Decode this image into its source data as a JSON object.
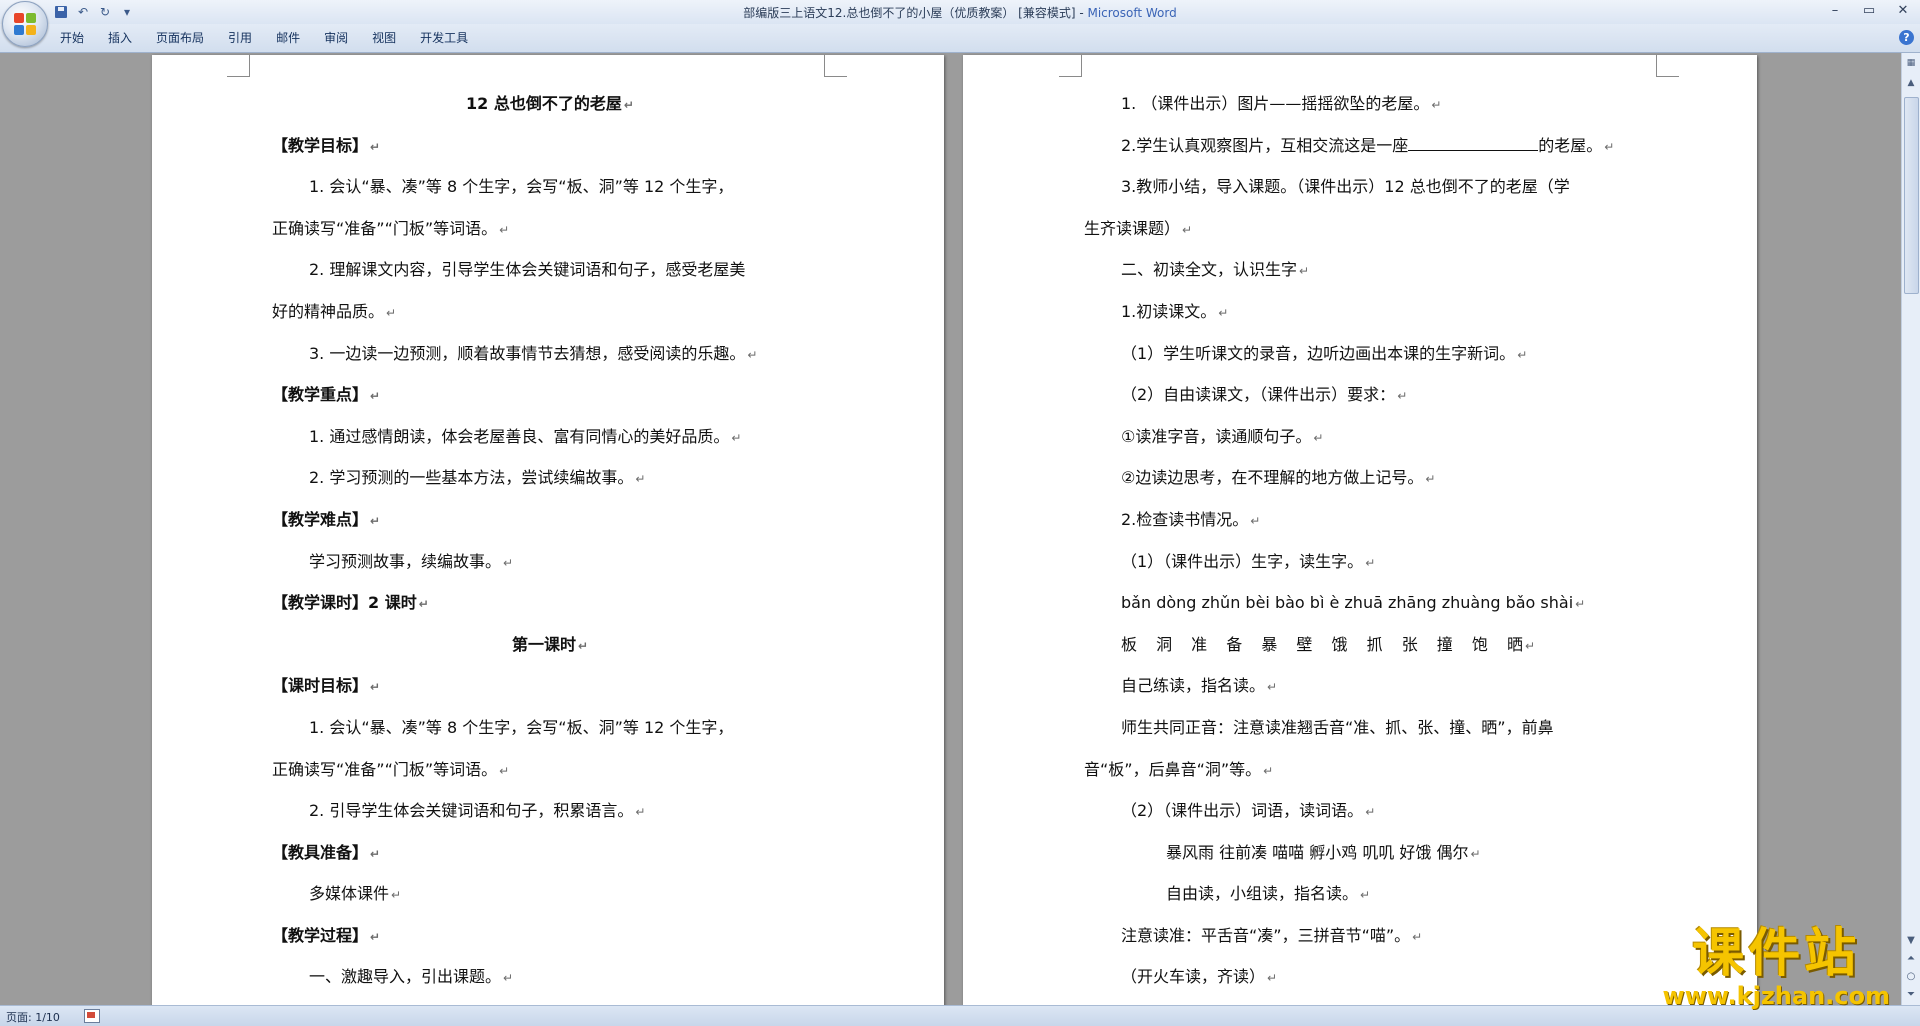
{
  "titlebar": {
    "title": "部编版三上语文12.总也倒不了的小屋（优质教案） [兼容模式] - ",
    "app": "Microsoft Word",
    "minimize": "–",
    "restore": "▭",
    "close": "✕"
  },
  "quick_access": {
    "undo_glyph": "↶",
    "redo_glyph": "↻",
    "customize_glyph": "▾"
  },
  "ribbon_tabs": [
    "开始",
    "插入",
    "页面布局",
    "引用",
    "邮件",
    "审阅",
    "视图",
    "开发工具"
  ],
  "help": "?",
  "paragraph_mark": "↵",
  "left_page": [
    {
      "text": "12 总也倒不了的老屋",
      "style": "center bold"
    },
    {
      "text": "【教学目标】",
      "style": "bold"
    },
    {
      "text": "1. 会认“暴、凑”等 8 个生字，会写“板、洞”等 12 个生字，",
      "style": "indent",
      "nomark": true
    },
    {
      "text": "正确读写“准备”“门板”等词语。",
      "style": ""
    },
    {
      "text": "2. 理解课文内容，引导学生体会关键词语和句子，感受老屋美",
      "style": "indent",
      "nomark": true
    },
    {
      "text": "好的精神品质。",
      "style": ""
    },
    {
      "text": "3. 一边读一边预测，顺着故事情节去猜想，感受阅读的乐趣。",
      "style": "indent"
    },
    {
      "text": "【教学重点】",
      "style": "bold"
    },
    {
      "text": "1. 通过感情朗读，体会老屋善良、富有同情心的美好品质。",
      "style": "indent"
    },
    {
      "text": "2. 学习预测的一些基本方法，尝试续编故事。",
      "style": "indent"
    },
    {
      "text": "【教学难点】",
      "style": "bold"
    },
    {
      "text": "学习预测故事，续编故事。",
      "style": "indent"
    },
    {
      "text": "【教学课时】2 课时",
      "style": "bold"
    },
    {
      "text": "第一课时",
      "style": "center bold"
    },
    {
      "text": "【课时目标】",
      "style": "bold"
    },
    {
      "text": "1. 会认“暴、凑”等 8 个生字，会写“板、洞”等 12 个生字，",
      "style": "indent",
      "nomark": true
    },
    {
      "text": "正确读写“准备”“门板”等词语。",
      "style": ""
    },
    {
      "text": "2. 引导学生体会关键词语和句子，积累语言。",
      "style": "indent"
    },
    {
      "text": "【教具准备】",
      "style": "bold"
    },
    {
      "text": "多媒体课件",
      "style": "indent"
    },
    {
      "text": "【教学过程】",
      "style": "bold"
    },
    {
      "text": "一、激趣导入，引出课题。",
      "style": "indent"
    }
  ],
  "right_page": [
    {
      "text": "1. （课件出示）图片——摇摇欲坠的老屋。",
      "style": "indent"
    },
    {
      "text": "2.学生认真观察图片，互相交流这是一座",
      "tail": "的老屋。",
      "blank": true,
      "style": "indent"
    },
    {
      "text": "3.教师小结，导入课题。（课件出示）12 总也倒不了的老屋（学",
      "style": "indent",
      "nomark": true
    },
    {
      "text": "生齐读课题）",
      "style": ""
    },
    {
      "text": "二、初读全文，认识生字",
      "style": "indent"
    },
    {
      "text": "1.初读课文。",
      "style": "indent"
    },
    {
      "text": "（1）学生听课文的录音，边听边画出本课的生字新词。",
      "style": "indent"
    },
    {
      "text": "（2）自由读课文，（课件出示）要求：",
      "style": "indent"
    },
    {
      "text": "①读准字音，读通顺句子。",
      "style": "indent"
    },
    {
      "text": "②边读边思考，在不理解的地方做上记号。",
      "style": "indent"
    },
    {
      "text": "2.检查读书情况。",
      "style": "indent"
    },
    {
      "text": "（1）（课件出示）生字，读生字。",
      "style": "indent"
    },
    {
      "text": "bǎn dòng zhǔn bèi bào bì è zhuā zhāng zhuàng bǎo shài",
      "style": "indent"
    },
    {
      "text": "板 洞 准 备 暴 壁 饿 抓 张 撞 饱 晒",
      "style": "indent spaced"
    },
    {
      "text": "自己练读，指名读。",
      "style": "indent"
    },
    {
      "text": "师生共同正音：注意读准翘舌音“准、抓、张、撞、晒”，前鼻",
      "style": "indent",
      "nomark": true
    },
    {
      "text": "音“板”，后鼻音“洞”等。",
      "style": ""
    },
    {
      "text": "（2）（课件出示）词语，读词语。",
      "style": "indent"
    },
    {
      "text": "暴风雨 往前凑 喵喵 孵小鸡 叽叽 好饿 偶尔",
      "style": "indent2"
    },
    {
      "text": "自由读，小组读，指名读。",
      "style": "indent2"
    },
    {
      "text": "注意读准：平舌音“凑”，三拼音节“喵”。",
      "style": "indent"
    },
    {
      "text": "（开火车读，齐读）",
      "style": "indent"
    }
  ],
  "status": {
    "page": "页面: 1/10"
  },
  "watermark": {
    "title": "课件站",
    "url": "www.kjzhan.com"
  },
  "colors": {
    "accent": "#3a64b6",
    "watermark": "#f5c400"
  }
}
